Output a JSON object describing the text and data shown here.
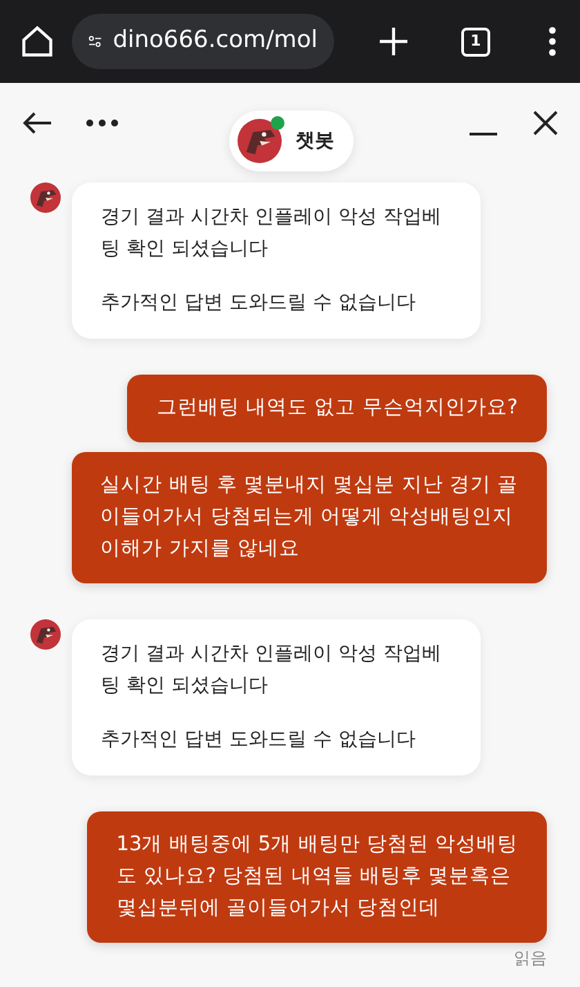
{
  "browser": {
    "url": "dino666.com/mol",
    "tab_count": "1"
  },
  "header": {
    "title": "챗봇",
    "online": true
  },
  "messages": [
    {
      "kind": "bot",
      "paragraphs": [
        [
          "경기 결과 시간차 인플레이 악성 작업베",
          "팅 확인 되셨습니다"
        ],
        [
          "추가적인 답변 도와드릴 수 없습니다"
        ]
      ]
    },
    {
      "kind": "user",
      "paragraphs": [
        [
          "그런배팅 내역도 없고 무슨억지인가요?"
        ]
      ]
    },
    {
      "kind": "user",
      "paragraphs": [
        [
          "실시간 배팅 후 몇분내지 몇십분 지난 경기 골",
          "이들어가서 당첨되는게 어떻게 악성배팅인지",
          "이해가 가지를 않네요"
        ]
      ]
    },
    {
      "kind": "bot",
      "paragraphs": [
        [
          "경기 결과 시간차 인플레이 악성 작업베",
          "팅 확인 되셨습니다"
        ],
        [
          "추가적인 답변 도와드릴 수 없습니다"
        ]
      ]
    },
    {
      "kind": "user",
      "paragraphs": [
        [
          "13개 배팅중에 5개 배팅만 당첨된 악성배팅",
          "도 있나요? 당첨된 내역들 배팅후 몇분혹은",
          "몇십분뒤에 골이들어가서 당첨인데"
        ]
      ]
    }
  ],
  "read_receipt": "읽음"
}
